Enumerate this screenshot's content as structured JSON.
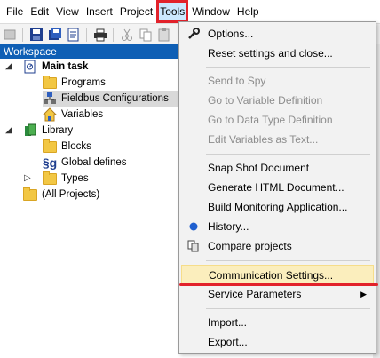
{
  "menubar": {
    "items": [
      {
        "label": "File"
      },
      {
        "label": "Edit"
      },
      {
        "label": "View"
      },
      {
        "label": "Insert"
      },
      {
        "label": "Project"
      },
      {
        "label": "Tools"
      },
      {
        "label": "Window"
      },
      {
        "label": "Help"
      }
    ]
  },
  "workspace": {
    "title": "Workspace",
    "tree": {
      "main_task": "Main task",
      "programs": "Programs",
      "fieldbus": "Fieldbus Configurations",
      "variables": "Variables",
      "library": "Library",
      "blocks": "Blocks",
      "global_defines": "Global defines",
      "types": "Types",
      "all_projects": "(All Projects)"
    }
  },
  "tools_menu": {
    "options": "Options...",
    "reset": "Reset settings and close...",
    "send_to_spy": "Send to Spy",
    "goto_var": "Go to Variable Definition",
    "goto_type": "Go to Data Type Definition",
    "edit_vars": "Edit Variables as Text...",
    "snapshot": "Snap Shot Document",
    "gen_html": "Generate HTML Document...",
    "build_monitor": "Build Monitoring Application...",
    "history": "History...",
    "compare": "Compare projects",
    "comm_settings": "Communication Settings...",
    "service_params": "Service Parameters",
    "import": "Import...",
    "export": "Export..."
  },
  "colors": {
    "highlight_red": "#e2222b",
    "workspace_header": "#0f5fb5",
    "hover_item": "#fbeebd"
  }
}
